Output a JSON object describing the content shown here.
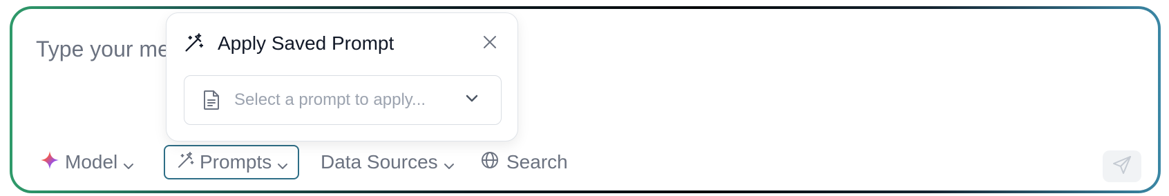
{
  "composer": {
    "placeholder": "Type your message..."
  },
  "toolbar": {
    "model_label": "Model",
    "prompts_label": "Prompts",
    "data_sources_label": "Data Sources",
    "search_label": "Search"
  },
  "popover": {
    "title": "Apply Saved Prompt",
    "select_placeholder": "Select a prompt to apply..."
  },
  "colors": {
    "accent_border": "#2e6e86",
    "muted_text": "#6b7280",
    "title_text": "#111827"
  }
}
